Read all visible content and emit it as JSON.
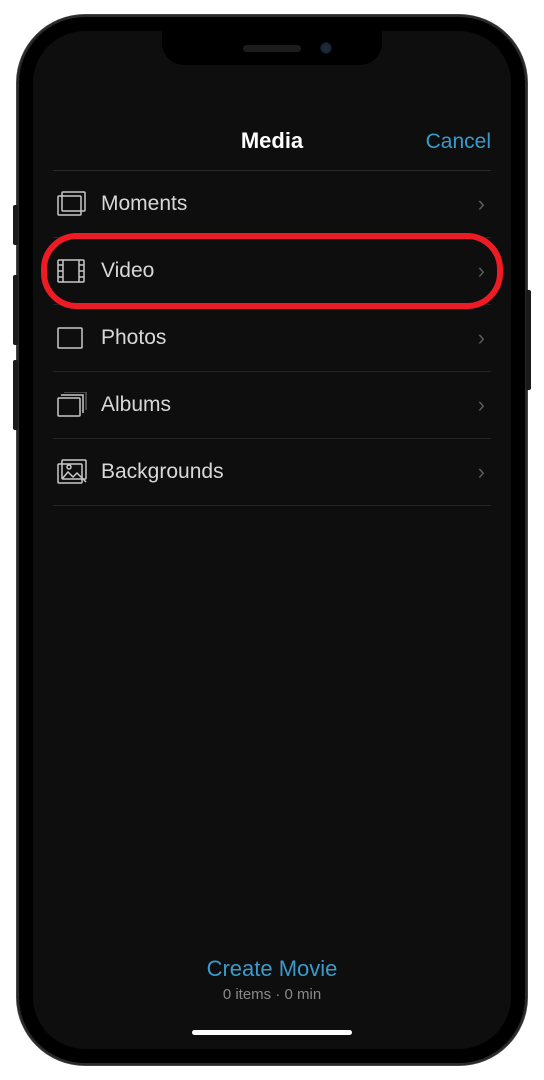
{
  "header": {
    "title": "Media",
    "cancel_label": "Cancel"
  },
  "list": {
    "items": [
      {
        "id": "moments",
        "label": "Moments",
        "icon": "moments-icon"
      },
      {
        "id": "video",
        "label": "Video",
        "icon": "video-icon",
        "highlighted": true
      },
      {
        "id": "photos",
        "label": "Photos",
        "icon": "photos-icon"
      },
      {
        "id": "albums",
        "label": "Albums",
        "icon": "albums-icon"
      },
      {
        "id": "backgrounds",
        "label": "Backgrounds",
        "icon": "backgrounds-icon"
      }
    ]
  },
  "footer": {
    "create_label": "Create Movie",
    "status": "0 items · 0 min"
  },
  "colors": {
    "accent": "#3a9acb",
    "highlight": "#ed1c24"
  }
}
